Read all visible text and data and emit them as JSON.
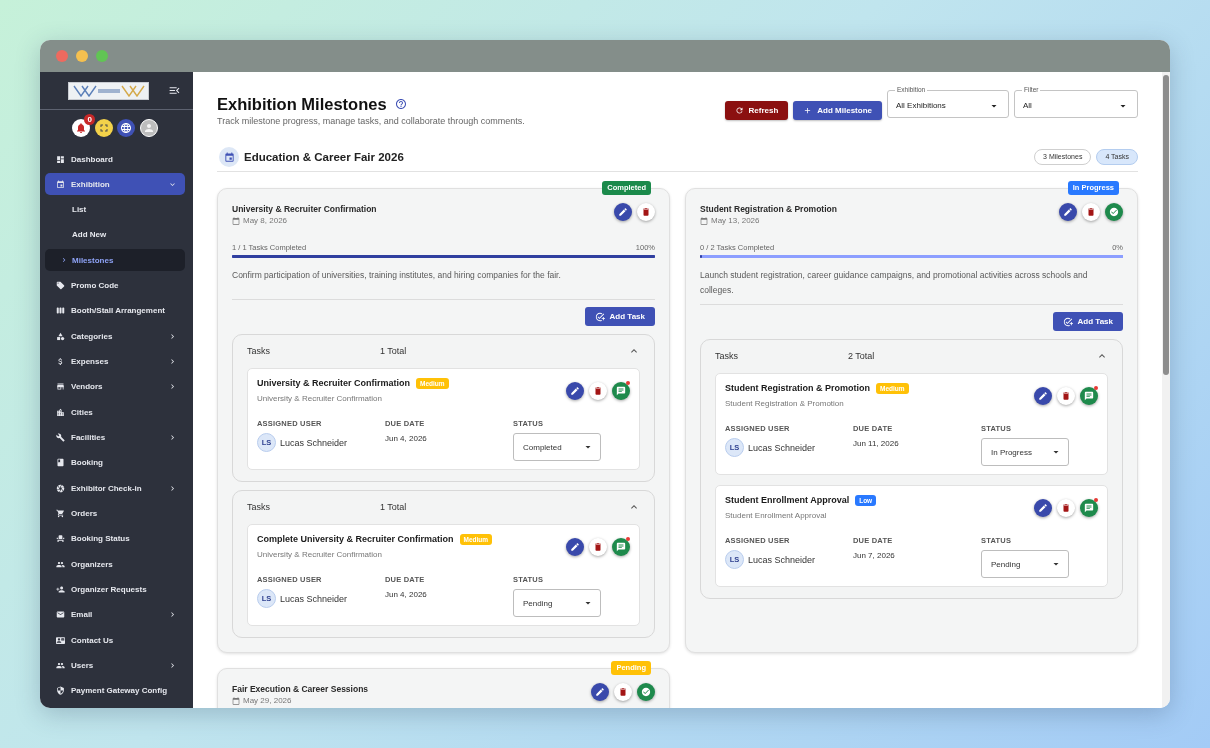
{
  "window": {
    "controls": [
      {
        "kind": "close"
      },
      {
        "kind": "minimize"
      },
      {
        "kind": "maximize"
      }
    ]
  },
  "sidebar": {
    "header_icons": [
      {
        "kind": "notifications",
        "badge": "0"
      },
      {
        "kind": "fullscreen"
      },
      {
        "kind": "language"
      },
      {
        "kind": "profile"
      }
    ],
    "items": [
      {
        "label": "Dashboard",
        "kind": "link",
        "selected": false
      },
      {
        "label": "Exhibition",
        "kind": "submenu",
        "selected": true,
        "expanded": true,
        "children": [
          {
            "label": "List",
            "selected": false
          },
          {
            "label": "Add New",
            "selected": false
          },
          {
            "label": "Milestones",
            "selected": true
          }
        ]
      },
      {
        "label": "Promo Code",
        "kind": "link",
        "selected": false
      },
      {
        "label": "Booth/Stall Arrangement",
        "kind": "link",
        "selected": false
      },
      {
        "label": "Categories",
        "kind": "submenu",
        "selected": false,
        "expanded": false
      },
      {
        "label": "Expenses",
        "kind": "submenu",
        "selected": false,
        "expanded": false
      },
      {
        "label": "Vendors",
        "kind": "submenu",
        "selected": false,
        "expanded": false
      },
      {
        "label": "Cities",
        "kind": "link",
        "selected": false
      },
      {
        "label": "Facilities",
        "kind": "submenu",
        "selected": false,
        "expanded": false
      },
      {
        "label": "Booking",
        "kind": "link",
        "selected": false
      },
      {
        "label": "Exhibitor Check-in",
        "kind": "submenu",
        "selected": false,
        "expanded": false
      },
      {
        "label": "Orders",
        "kind": "link",
        "selected": false
      },
      {
        "label": "Booking Status",
        "kind": "link",
        "selected": false
      },
      {
        "label": "Organizers",
        "kind": "link",
        "selected": false
      },
      {
        "label": "Organizer Requests",
        "kind": "link",
        "selected": false
      },
      {
        "label": "Email",
        "kind": "submenu",
        "selected": false,
        "expanded": false
      },
      {
        "label": "Contact Us",
        "kind": "link",
        "selected": false
      },
      {
        "label": "Users",
        "kind": "submenu",
        "selected": false,
        "expanded": false
      },
      {
        "label": "Payment Gateway Config",
        "kind": "link",
        "selected": false
      }
    ]
  },
  "header": {
    "title": "Exhibition Milestones",
    "subtitle": "Track milestone progress, manage tasks, and collaborate through comments.",
    "buttons": [
      {
        "label": "Refresh",
        "kind": "refresh"
      },
      {
        "label": "Add Milestone",
        "kind": "add"
      }
    ],
    "filters": [
      {
        "label": "Exhibition",
        "value": "All Exhibitions"
      },
      {
        "label": "Filter",
        "value": "All"
      }
    ]
  },
  "exhibition": {
    "title": "Education & Career Fair 2026",
    "chips": [
      {
        "label": "3 Milestones",
        "kind": "outline"
      },
      {
        "label": "4 Tasks",
        "kind": "tinted"
      }
    ]
  },
  "milestones": [
    {
      "title": "University & Recruiter Confirmation",
      "date": "May 8, 2026",
      "status": {
        "label": "Completed",
        "color": "#1b8a4b"
      },
      "actions": [
        {
          "kind": "edit"
        },
        {
          "kind": "delete"
        }
      ],
      "progress": {
        "label": "1 / 1 Tasks Completed",
        "percent": "100%",
        "level": 1
      },
      "description": "Confirm participation of universities, training institutes, and hiring companies for the fair.",
      "add_task_label": "Add Task",
      "task_groups": [
        {
          "title": "Tasks",
          "count": "1 Total",
          "expanded": true,
          "tasks": [
            {
              "title": "University & Recruiter Confirmation",
              "priority": {
                "label": "Medium",
                "color": "#ffc107"
              },
              "subtitle": "University & Recruiter Confirmation",
              "actions": [
                {
                  "kind": "edit"
                },
                {
                  "kind": "delete"
                },
                {
                  "kind": "comments",
                  "unread": true
                }
              ],
              "assigned_label": "ASSIGNED USER",
              "assignee": {
                "initials": "LS",
                "name": "Lucas Schneider"
              },
              "due_label": "DUE DATE",
              "due_date": "Jun 4, 2026",
              "status_label": "STATUS",
              "status": "Completed"
            }
          ]
        },
        {
          "title": "Tasks",
          "count": "1 Total",
          "expanded": true,
          "tasks": [
            {
              "title": "Complete University & Recruiter Confirmation",
              "priority": {
                "label": "Medium",
                "color": "#ffc107"
              },
              "subtitle": "University & Recruiter Confirmation",
              "actions": [
                {
                  "kind": "edit"
                },
                {
                  "kind": "delete"
                },
                {
                  "kind": "comments",
                  "unread": true
                }
              ],
              "assigned_label": "ASSIGNED USER",
              "assignee": {
                "initials": "LS",
                "name": "Lucas Schneider"
              },
              "due_label": "DUE DATE",
              "due_date": "Jun 4, 2026",
              "status_label": "STATUS",
              "status": "Pending"
            }
          ]
        }
      ]
    },
    {
      "title": "Student Registration & Promotion",
      "date": "May 13, 2026",
      "status": {
        "label": "In Progress",
        "color": "#2979ff"
      },
      "actions": [
        {
          "kind": "edit"
        },
        {
          "kind": "delete"
        },
        {
          "kind": "complete"
        }
      ],
      "progress": {
        "label": "0 / 2 Tasks Completed",
        "percent": "0%",
        "level": 0
      },
      "description": "Launch student registration, career guidance campaigns, and promotional activities across schools and colleges.",
      "add_task_label": "Add Task",
      "task_groups": [
        {
          "title": "Tasks",
          "count": "2 Total",
          "expanded": true,
          "tasks": [
            {
              "title": "Student Registration & Promotion",
              "priority": {
                "label": "Medium",
                "color": "#ffc107"
              },
              "subtitle": "Student Registration & Promotion",
              "actions": [
                {
                  "kind": "edit"
                },
                {
                  "kind": "delete"
                },
                {
                  "kind": "comments",
                  "unread": true
                }
              ],
              "assigned_label": "ASSIGNED USER",
              "assignee": {
                "initials": "LS",
                "name": "Lucas Schneider"
              },
              "due_label": "DUE DATE",
              "due_date": "Jun 11, 2026",
              "status_label": "STATUS",
              "status": "In Progress"
            },
            {
              "title": "Student Enrollment Approval",
              "priority": {
                "label": "Low",
                "color": "#2979ff"
              },
              "subtitle": "Student Enrollment Approval",
              "actions": [
                {
                  "kind": "edit"
                },
                {
                  "kind": "delete"
                },
                {
                  "kind": "comments",
                  "unread": true
                }
              ],
              "assigned_label": "ASSIGNED USER",
              "assignee": {
                "initials": "LS",
                "name": "Lucas Schneider"
              },
              "due_label": "DUE DATE",
              "due_date": "Jun 7, 2026",
              "status_label": "STATUS",
              "status": "Pending"
            }
          ]
        }
      ]
    },
    {
      "title": "Fair Execution & Career Sessions",
      "date": "May 29, 2026",
      "status": {
        "label": "Pending",
        "color": "#ffc107"
      },
      "actions": [
        {
          "kind": "edit"
        },
        {
          "kind": "delete"
        },
        {
          "kind": "complete"
        }
      ]
    }
  ]
}
